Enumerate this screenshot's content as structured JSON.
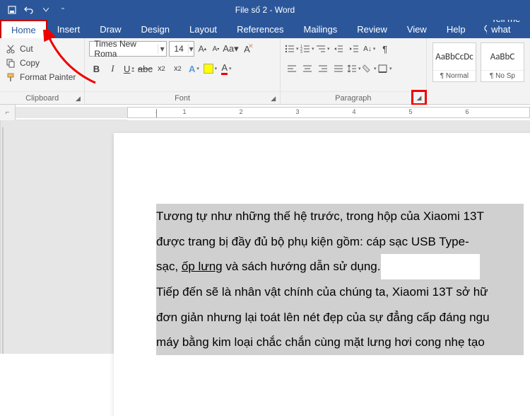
{
  "titlebar": {
    "doc_title": "File số 2  -  Word"
  },
  "tabs": {
    "items": [
      "Home",
      "Insert",
      "Draw",
      "Design",
      "Layout",
      "References",
      "Mailings",
      "Review",
      "View",
      "Help"
    ],
    "active": 0,
    "tellme": "Tell me what you"
  },
  "clipboard": {
    "cut": "Cut",
    "copy": "Copy",
    "painter": "Format Painter",
    "label": "Clipboard"
  },
  "font": {
    "name": "Times New Roma",
    "size": "14",
    "label": "Font"
  },
  "paragraph": {
    "label": "Paragraph"
  },
  "styles": {
    "items": [
      {
        "preview": "AaBbCcDc",
        "name": "¶ Normal"
      },
      {
        "preview": "AaBbC",
        "name": "¶ No Sp"
      }
    ]
  },
  "document": {
    "p1": "Tương tự như những thế hệ trước, trong hộp của Xiaomi 13T ",
    "p2": "được trang bị đầy đủ bộ phụ kiện gồm: cáp sạc USB Type-",
    "p3a": "sạc, ",
    "p3b": "ốp lưng",
    "p3c": " và sách hướng dẫn sử dụng.",
    "p4": "Tiếp đến sẽ là nhân vật chính của chúng ta, Xiaomi 13T sở hữ",
    "p5": "đơn giản nhưng lại toát lên nét đẹp của sự đẳng cấp đáng ngu",
    "p6": "máy bằng kim loại chắc chắn cùng mặt lưng hơi cong nhẹ tạo"
  }
}
